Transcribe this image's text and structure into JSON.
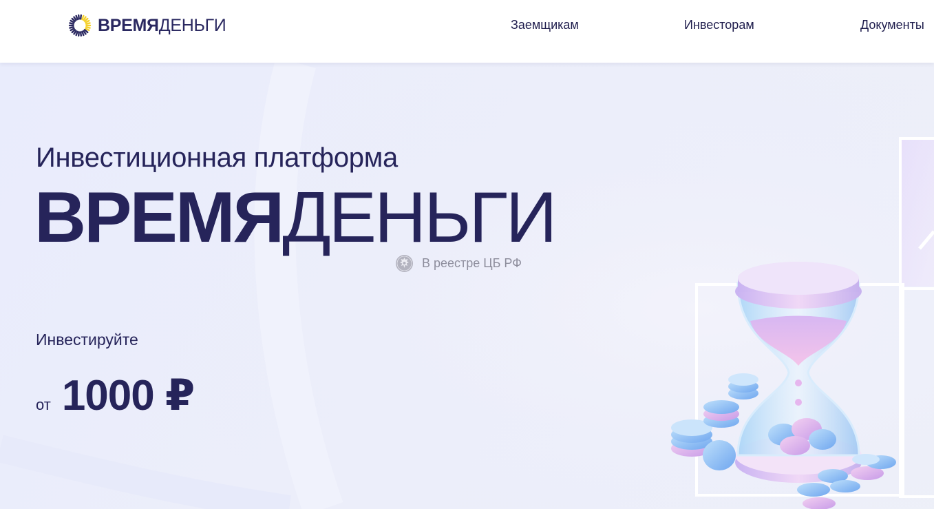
{
  "header": {
    "logo": {
      "bold": "ВРЕМЯ",
      "thin": "ДЕНЬГИ"
    },
    "nav": [
      {
        "label": "Заемщикам"
      },
      {
        "label": "Инвесторам"
      },
      {
        "label": "Документы"
      }
    ]
  },
  "hero": {
    "subtitle": "Инвестиционная платформа",
    "title": {
      "bold": "ВРЕМЯ",
      "thin": "ДЕНЬГИ"
    },
    "registry": "В реестре ЦБ РФ",
    "invest_label": "Инвестируйте",
    "amount_prefix": "от",
    "amount_value": "1000 ₽"
  },
  "icons": {
    "logo": "sunburst-logo-icon",
    "registry": "central-bank-emblem-icon"
  },
  "colors": {
    "primary_text": "#26245a",
    "logo_accent": "#f5d02a",
    "muted_text": "#8d8d9c"
  }
}
